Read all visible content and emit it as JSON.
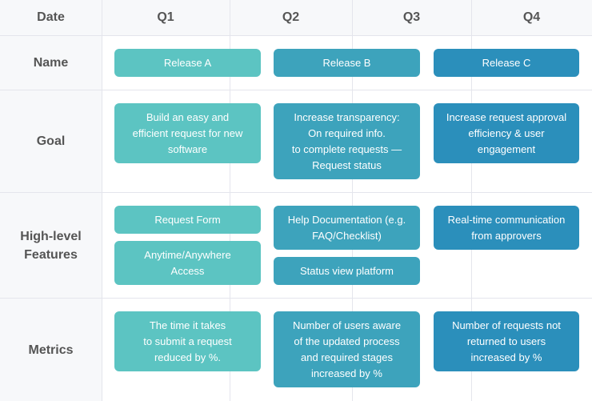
{
  "header": {
    "date_label": "Date",
    "quarters": [
      "Q1",
      "Q2",
      "Q3",
      "Q4"
    ]
  },
  "rows": {
    "name": "Name",
    "goal": "Goal",
    "features": "High-level\nFeatures",
    "metrics": "Metrics"
  },
  "releases": {
    "a": {
      "name": "Release A",
      "goal": "Build an easy and\nefficient request for new\nsoftware",
      "features": [
        "Request Form",
        "Anytime/Anywhere\nAccess"
      ],
      "metric": "The time it takes\nto submit a request\nreduced by %."
    },
    "b": {
      "name": "Release B",
      "goal": "Increase transparency:\nOn required info.\nto complete requests —\nRequest status",
      "features": [
        "Help Documentation (e.g.\nFAQ/Checklist)",
        "Status view platform"
      ],
      "metric": "Number of users aware\nof the updated process\nand required stages\nincreased by %"
    },
    "c": {
      "name": "Release C",
      "goal": "Increase request approval\nefficiency & user\nengagement",
      "features": [
        "Real-time communication\nfrom approvers"
      ],
      "metric": "Number of requests not\nreturned to users\nincreased by %"
    }
  },
  "colors": {
    "release_a": "#5cc4c2",
    "release_b": "#3da3bc",
    "release_c": "#2b8fbb",
    "label_text": "#555555",
    "grid_line": "#e4e5ec",
    "header_bg": "#f7f8fa"
  }
}
